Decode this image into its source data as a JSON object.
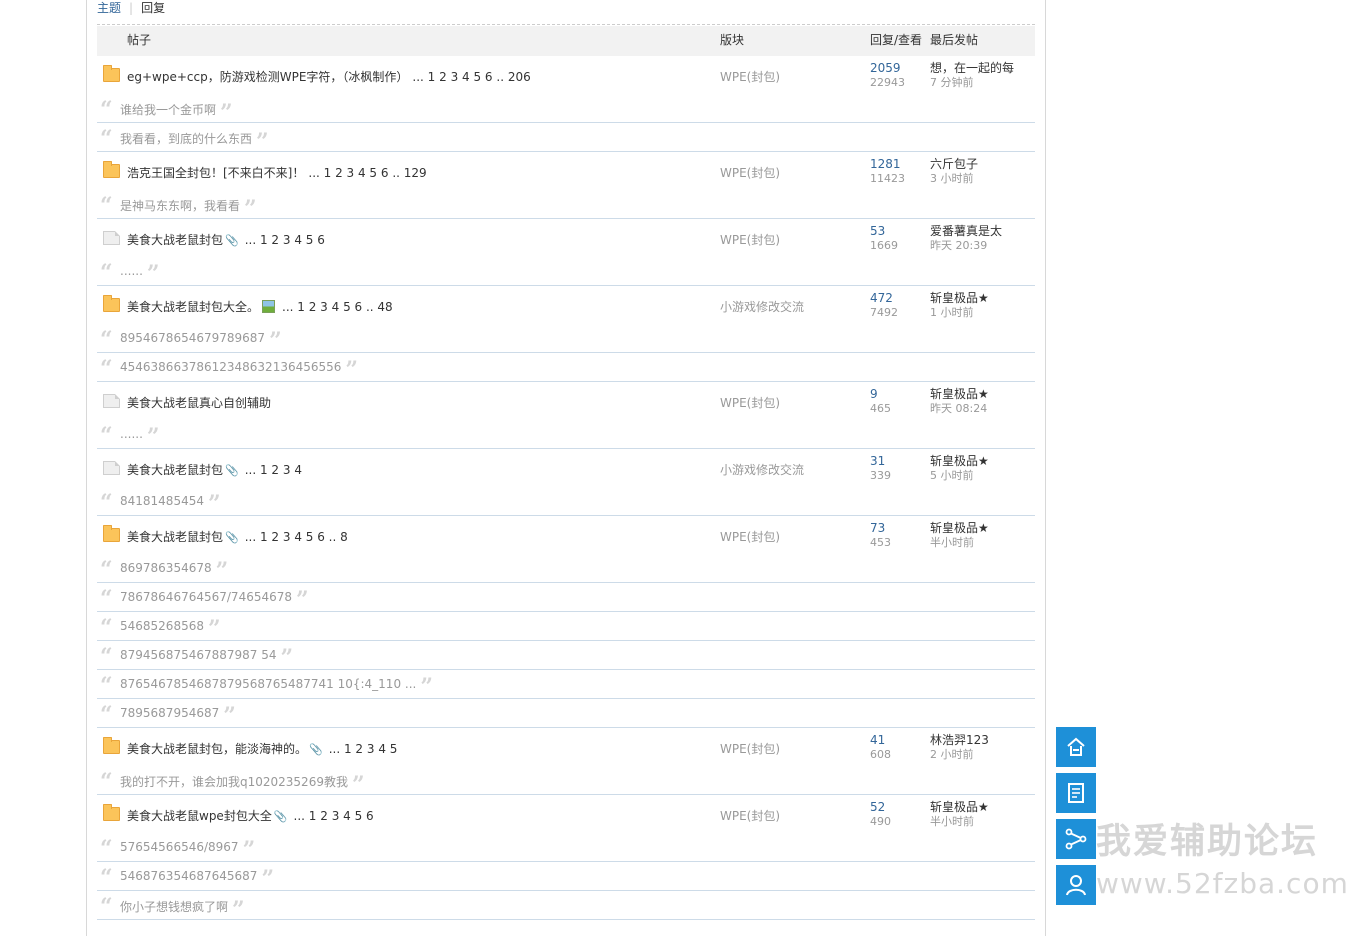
{
  "tabs": {
    "active": "主题",
    "other": "回复"
  },
  "headers": {
    "post": "帖子",
    "forum": "版块",
    "stats": "回复/查看",
    "last": "最后发帖"
  },
  "threads": [
    {
      "icon": "folder",
      "title": "eg+wpe+ccp，防游戏检测WPE字符，（冰枫制作）",
      "pages": "... 1 2 3 4 5 6 .. 206",
      "forum": "WPE(封包)",
      "replies": "2059",
      "views": "22943",
      "last_user": "想，在一起的每",
      "last_time": "7 分钟前",
      "quotes": [
        "谁给我一个金币啊",
        "我看看，到底的什么东西"
      ]
    },
    {
      "icon": "folder",
      "title": "浩克王国全封包！[不来白不来]！",
      "pages": "... 1 2 3 4 5 6 .. 129",
      "forum": "WPE(封包)",
      "replies": "1281",
      "views": "11423",
      "last_user": "六斤包子",
      "last_time": "3 小时前",
      "quotes": [
        "是神马东东啊，我看看"
      ]
    },
    {
      "icon": "doc",
      "title": "美食大战老鼠封包",
      "attach": true,
      "pages": "... 1 2 3 4 5 6",
      "forum": "WPE(封包)",
      "replies": "53",
      "views": "1669",
      "last_user": "爱番薯真是太",
      "last_time": "昨天 20:39",
      "quotes": [
        "......"
      ]
    },
    {
      "icon": "folder",
      "title": "美食大战老鼠封包大全。",
      "image": true,
      "pages": "... 1 2 3 4 5 6 .. 48",
      "forum": "小游戏修改交流",
      "replies": "472",
      "views": "7492",
      "last_user": "斩皇极品★",
      "last_time": "1 小时前",
      "quotes": [
        "8954678654679789687",
        "45463866378612348632136456556"
      ]
    },
    {
      "icon": "doc",
      "title": "美食大战老鼠真心自创辅助",
      "pages": "",
      "forum": "WPE(封包)",
      "replies": "9",
      "views": "465",
      "last_user": "斩皇极品★",
      "last_time": "昨天 08:24",
      "quotes": [
        "......"
      ]
    },
    {
      "icon": "doc",
      "title": "美食大战老鼠封包",
      "attach": true,
      "pages": "... 1 2 3 4",
      "forum": "小游戏修改交流",
      "replies": "31",
      "views": "339",
      "last_user": "斩皇极品★",
      "last_time": "5 小时前",
      "quotes": [
        "84181485454"
      ]
    },
    {
      "icon": "folder",
      "title": "美食大战老鼠封包",
      "attach": true,
      "pages": "... 1 2 3 4 5 6 .. 8",
      "forum": "WPE(封包)",
      "replies": "73",
      "views": "453",
      "last_user": "斩皇极品★",
      "last_time": "半小时前",
      "quotes": [
        "869786354678",
        "78678646764567/74654678",
        "54685268568",
        "879456875467887987 54",
        "8765467854687879568765487741 10{:4_110 ...",
        "7895687954687"
      ]
    },
    {
      "icon": "folder",
      "title": "美食大战老鼠封包，能淡海神的。",
      "attach": true,
      "pages": "... 1 2 3 4 5",
      "forum": "WPE(封包)",
      "replies": "41",
      "views": "608",
      "last_user": "林浩羿123",
      "last_time": "2 小时前",
      "quotes": [
        "我的打不开，谁会加我q1020235269教我"
      ]
    },
    {
      "icon": "folder",
      "title": "美食大战老鼠wpe封包大全",
      "attach": true,
      "pages": "... 1 2 3 4 5 6",
      "forum": "WPE(封包)",
      "replies": "52",
      "views": "490",
      "last_user": "斩皇极品★",
      "last_time": "半小时前",
      "quotes": [
        "57654566546/8967",
        "546876354687645687",
        "你小子想钱想疯了啊"
      ]
    }
  ],
  "watermark": {
    "name": "我爱辅助论坛",
    "url": "www.52fzba.com"
  },
  "side_buttons": [
    "top-icon",
    "document-icon",
    "share-icon",
    "user-icon"
  ]
}
